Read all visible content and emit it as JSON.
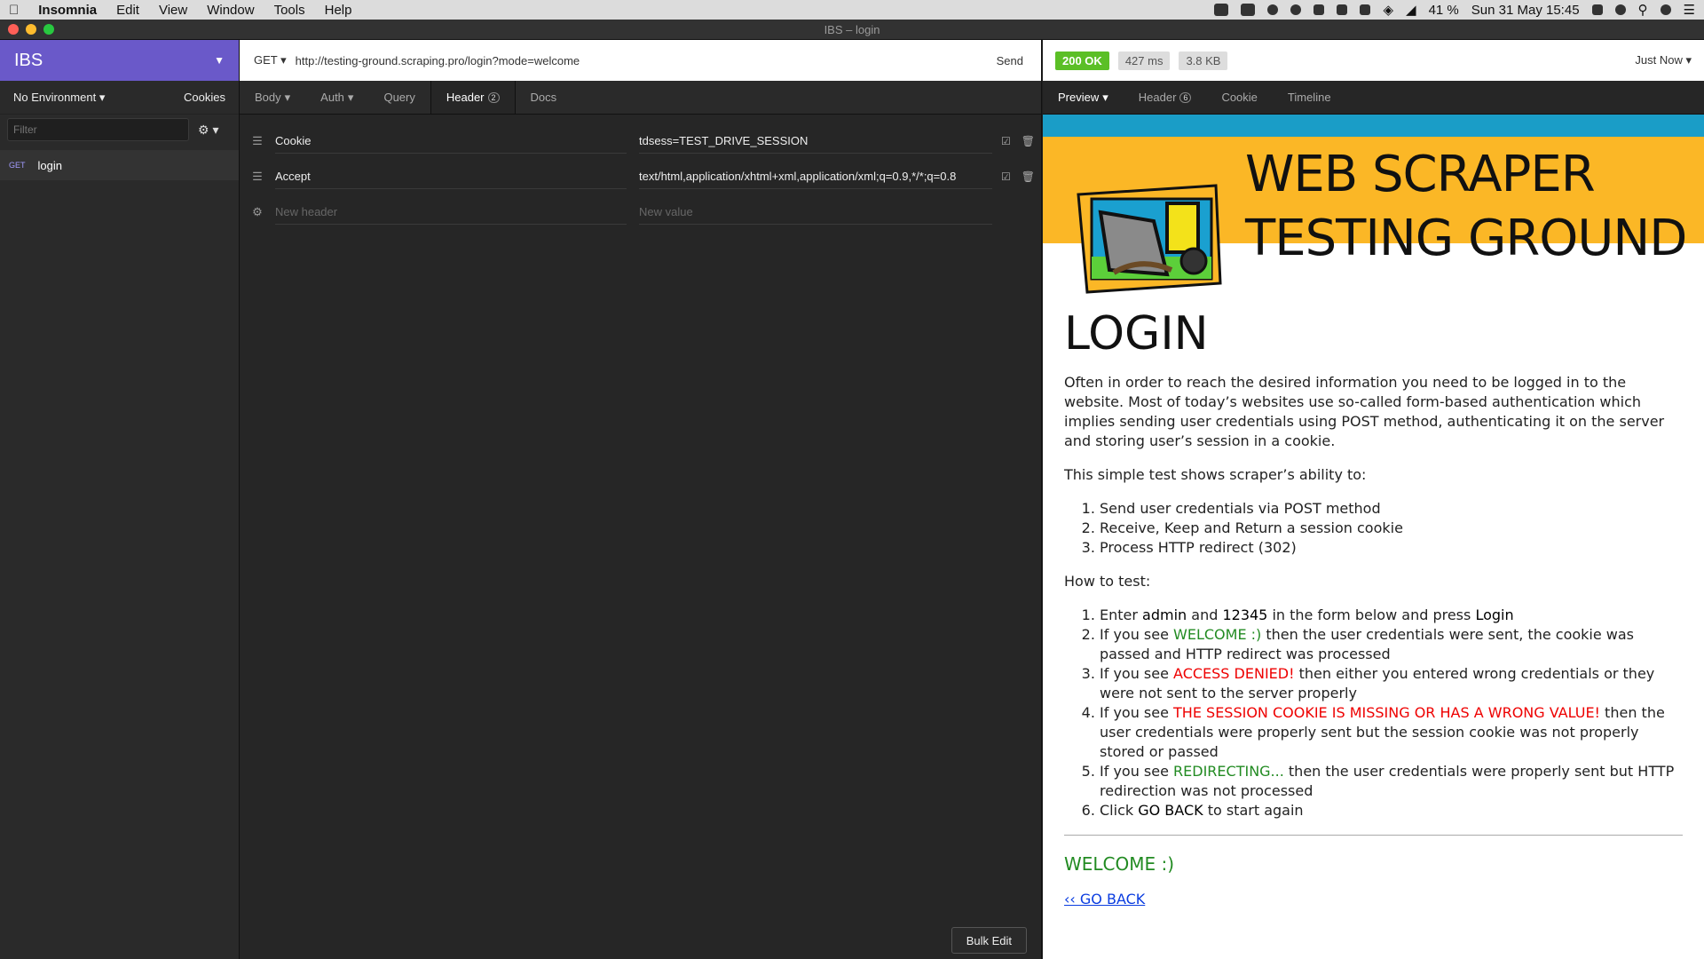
{
  "menubar": {
    "app": "Insomnia",
    "menus": [
      "Edit",
      "View",
      "Window",
      "Tools",
      "Help"
    ],
    "battery": "41 %",
    "datetime": "Sun 31 May  15:45"
  },
  "window": {
    "title": "IBS – login"
  },
  "sidebar": {
    "workspace": "IBS",
    "environment": "No Environment",
    "cookies": "Cookies",
    "filter_placeholder": "Filter",
    "requests": [
      {
        "method": "GET",
        "name": "login"
      }
    ]
  },
  "request": {
    "method": "GET",
    "url": "http://testing-ground.scraping.pro/login?mode=welcome",
    "send": "Send",
    "tabs": [
      {
        "label": "Body"
      },
      {
        "label": "Auth"
      },
      {
        "label": "Query"
      },
      {
        "label": "Header",
        "count": "2"
      },
      {
        "label": "Docs"
      }
    ],
    "headers": [
      {
        "name": "Cookie",
        "value": "tdsess=TEST_DRIVE_SESSION"
      },
      {
        "name": "Accept",
        "value": "text/html,application/xhtml+xml,application/xml;q=0.9,*/*;q=0.8"
      }
    ],
    "new_header_placeholder": "New header",
    "new_value_placeholder": "New value",
    "bulk_edit": "Bulk Edit"
  },
  "response": {
    "status": "200 OK",
    "time": "427 ms",
    "size": "3.8 KB",
    "when": "Just Now",
    "tabs": [
      {
        "label": "Preview"
      },
      {
        "label": "Header",
        "count": "6"
      },
      {
        "label": "Cookie"
      },
      {
        "label": "Timeline"
      }
    ],
    "colors": {
      "ok": "#5bbf26",
      "banner": "#fbb726",
      "accent": "#6a59c9"
    }
  },
  "page": {
    "title_line1": "WEB SCRAPER",
    "title_line2": "TESTING GROUND",
    "heading": "LOGIN",
    "intro": "Often in order to reach the desired information you need to be logged in to the website. Most of today’s websites use so-called form-based authentication which implies sending user credentials using POST method, authenticating it on the server and storing user’s session in a cookie.",
    "ability": "This simple test shows scraper’s ability to:",
    "abilities": [
      "Send user credentials via POST method",
      "Receive, Keep and Return a session cookie",
      "Process HTTP redirect (302)"
    ],
    "how": "How to test:",
    "steps": {
      "s1_a": "Enter ",
      "s1_admin": "admin",
      "s1_b": " and ",
      "s1_pw": "12345",
      "s1_c": " in the form below and press ",
      "s1_login": "Login",
      "s2_a": "If you see ",
      "s2_hl": "WELCOME :)",
      "s2_b": " then the user credentials were sent, the cookie was passed and HTTP redirect was processed",
      "s3_a": "If you see ",
      "s3_hl": "ACCESS DENIED!",
      "s3_b": " then either you entered wrong credentials or they were not sent to the server properly",
      "s4_a": "If you see ",
      "s4_hl": "THE SESSION COOKIE IS MISSING OR HAS A WRONG VALUE!",
      "s4_b": " then the user credentials were properly sent but the session cookie was not properly stored or passed",
      "s5_a": "If you see ",
      "s5_hl": "REDIRECTING...",
      "s5_b": " then the user credentials were properly sent but HTTP redirection was not processed",
      "s6_a": "Click ",
      "s6_hl": "GO BACK",
      "s6_b": " to start again"
    },
    "welcome": "WELCOME :)",
    "goback": "‹‹ GO BACK"
  }
}
